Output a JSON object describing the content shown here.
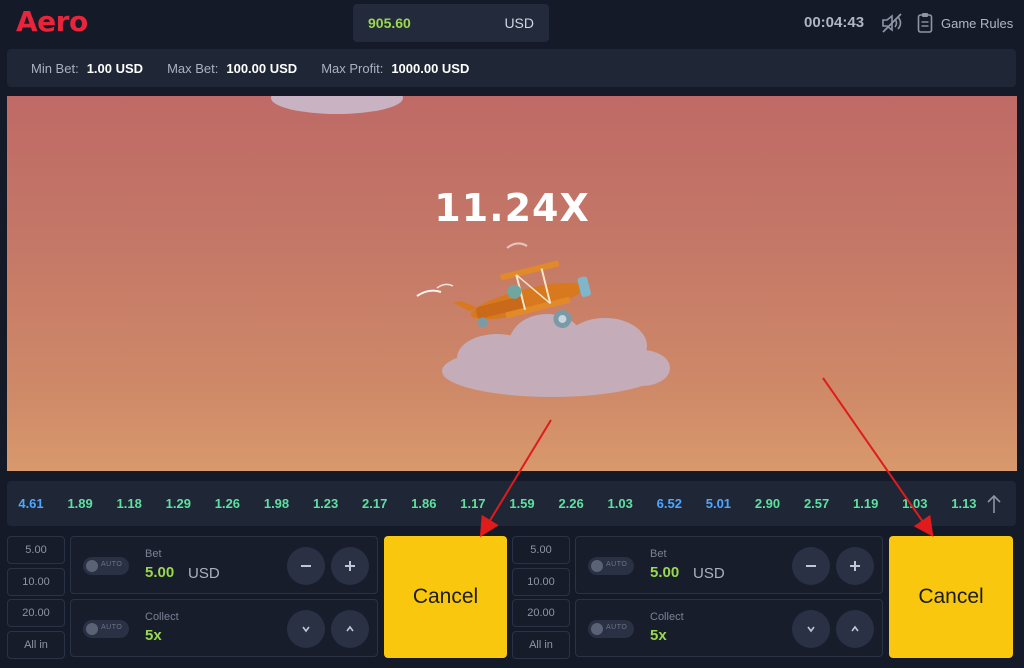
{
  "app": {
    "logo": "Aero"
  },
  "header": {
    "balance": "905.60",
    "currency": "USD",
    "clock": "00:04:43",
    "rules_label": "Game Rules",
    "icons": [
      "sound-muted-icon",
      "rules-icon"
    ]
  },
  "limits": {
    "min_bet_label": "Min Bet:",
    "min_bet": "1.00 USD",
    "max_bet_label": "Max Bet:",
    "max_bet": "100.00 USD",
    "max_profit_label": "Max Profit:",
    "max_profit": "1000.00 USD"
  },
  "game": {
    "multiplier": "11.24X"
  },
  "history": {
    "items": [
      {
        "v": "4.61",
        "c": "#4ea7ff"
      },
      {
        "v": "1.89",
        "c": "#5fe0a0"
      },
      {
        "v": "1.18",
        "c": "#5fe0a0"
      },
      {
        "v": "1.29",
        "c": "#5fe0a0"
      },
      {
        "v": "1.26",
        "c": "#5fe0a0"
      },
      {
        "v": "1.98",
        "c": "#5fe0a0"
      },
      {
        "v": "1.23",
        "c": "#5fe0a0"
      },
      {
        "v": "2.17",
        "c": "#5fe0a0"
      },
      {
        "v": "1.86",
        "c": "#5fe0a0"
      },
      {
        "v": "1.17",
        "c": "#5fe0a0"
      },
      {
        "v": "1.59",
        "c": "#5fe0a0"
      },
      {
        "v": "2.26",
        "c": "#5fe0a0"
      },
      {
        "v": "1.03",
        "c": "#5fe0a0"
      },
      {
        "v": "6.52",
        "c": "#4ea7ff"
      },
      {
        "v": "5.01",
        "c": "#4ea7ff"
      },
      {
        "v": "2.90",
        "c": "#5fe0a0"
      },
      {
        "v": "2.57",
        "c": "#5fe0a0"
      },
      {
        "v": "1.19",
        "c": "#5fe0a0"
      },
      {
        "v": "1.03",
        "c": "#5fe0a0"
      },
      {
        "v": "1.13",
        "c": "#5fe0a0"
      }
    ]
  },
  "panels": {
    "left": {
      "quick": [
        "5.00",
        "10.00",
        "20.00",
        "All in"
      ],
      "toggle_label": "AUTO",
      "bet_label": "Bet",
      "bet_value": "5.00",
      "bet_currency": "USD",
      "collect_label": "Collect",
      "collect_value": "5x",
      "cancel_label": "Cancel"
    },
    "right": {
      "quick": [
        "5.00",
        "10.00",
        "20.00",
        "All in"
      ],
      "toggle_label": "AUTO",
      "bet_label": "Bet",
      "bet_value": "5.00",
      "bet_currency": "USD",
      "collect_label": "Collect",
      "collect_value": "5x",
      "cancel_label": "Cancel"
    }
  },
  "colors": {
    "accent_yellow": "#f9c80e",
    "brand_red": "#e8253a",
    "value_green": "#9ad84d",
    "annotation_red": "#e01b1b"
  }
}
